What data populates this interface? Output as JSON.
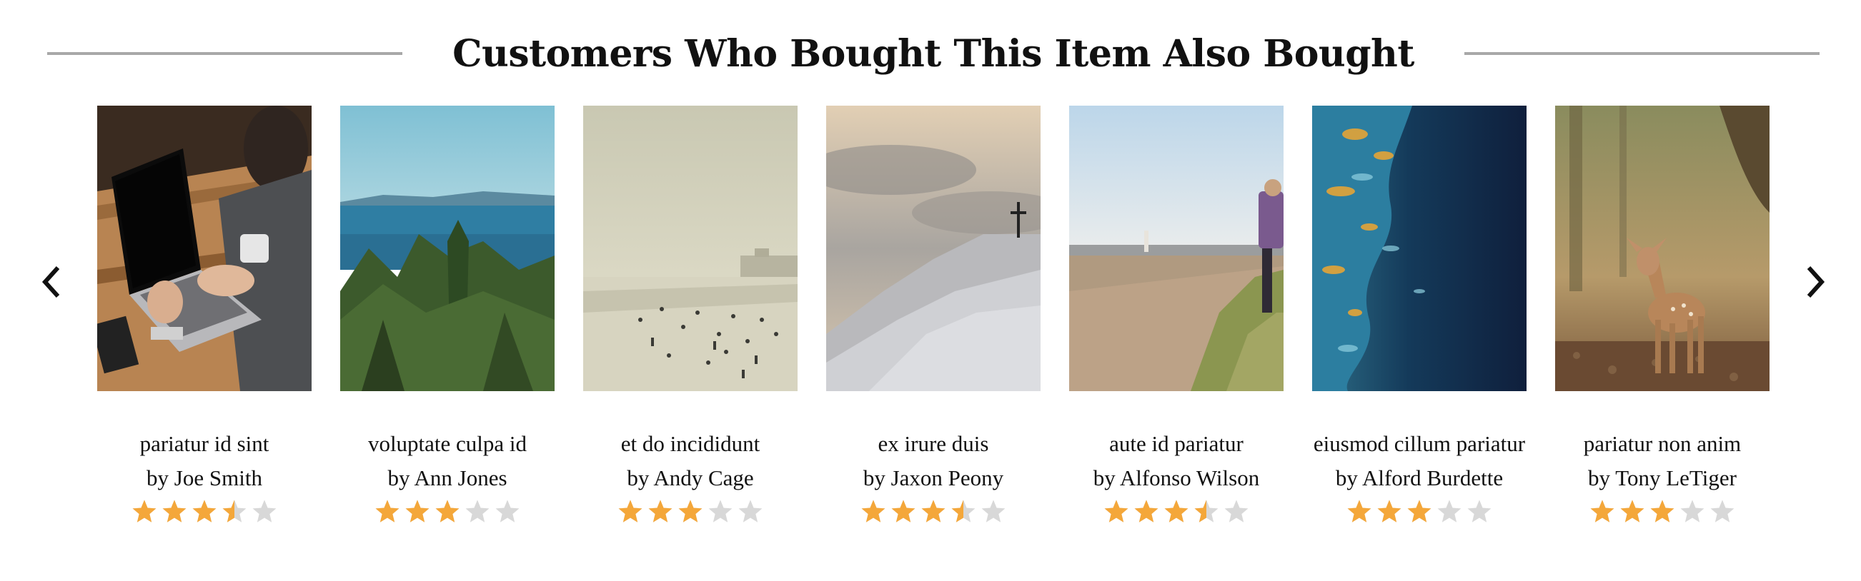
{
  "heading": "Customers Who Bought This Item Also Bought",
  "nav": {
    "prev_icon": "chevron-left-icon",
    "next_icon": "chevron-right-icon"
  },
  "colors": {
    "star_filled": "#f4a73a",
    "star_empty": "#d8d8d8",
    "rule": "#a8a8a8",
    "text": "#111111"
  },
  "items": [
    {
      "title": "pariatur id sint",
      "author": "by Joe Smith",
      "rating": 3.5,
      "image": "person-laptop-photo"
    },
    {
      "title": "voluptate culpa id",
      "author": "by Ann Jones",
      "rating": 3,
      "image": "coastal-forest-photo"
    },
    {
      "title": "et do incididunt",
      "author": "by Andy Cage",
      "rating": 3,
      "image": "misty-beach-photo"
    },
    {
      "title": "ex irure duis",
      "author": "by Jaxon Peony",
      "rating": 3.5,
      "image": "snowy-hill-cross-photo"
    },
    {
      "title": "aute id pariatur",
      "author": "by Alfonso Wilson",
      "rating": 3.5,
      "image": "beach-hiker-photo"
    },
    {
      "title": "eiusmod cillum pariatur",
      "author": "by Alford Burdette",
      "rating": 3,
      "image": "ocean-aerial-photo"
    },
    {
      "title": "pariatur non anim",
      "author": "by Tony LeTiger",
      "rating": 3,
      "image": "deer-forest-photo"
    }
  ]
}
